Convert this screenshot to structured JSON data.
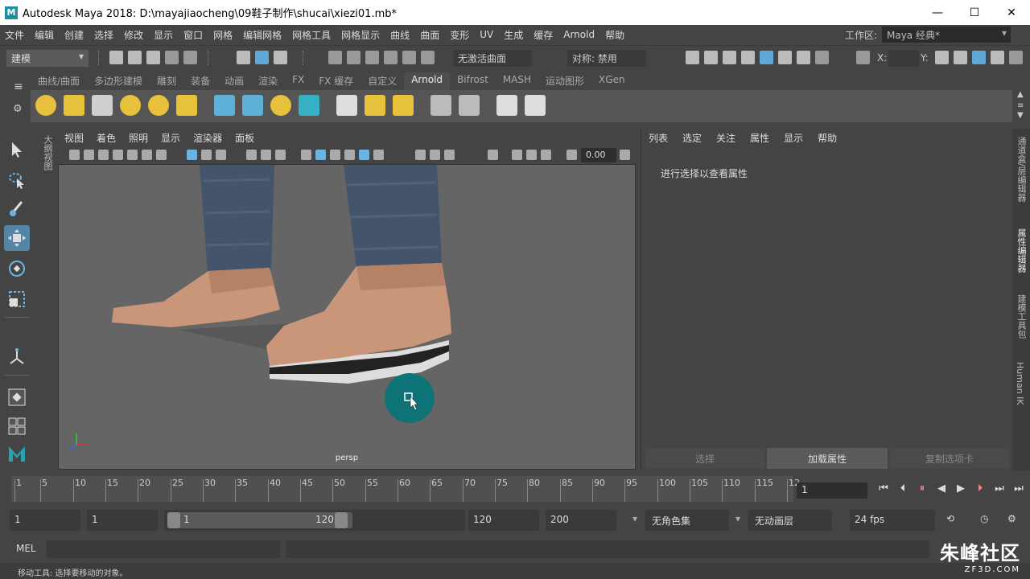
{
  "window": {
    "title": "Autodesk Maya 2018: D:\\mayajiaocheng\\09鞋子制作\\shucai\\xiezi01.mb*",
    "logo": "M",
    "minimize": "—",
    "maximize": "☐",
    "close": "✕"
  },
  "menubar": {
    "items": [
      "文件",
      "编辑",
      "创建",
      "选择",
      "修改",
      "显示",
      "窗口",
      "网格",
      "编辑网格",
      "网格工具",
      "网格显示",
      "曲线",
      "曲面",
      "变形",
      "UV",
      "生成",
      "缓存",
      "Arnold",
      "帮助"
    ],
    "workspace_label": "工作区:",
    "workspace_value": "Maya 经典*"
  },
  "statusline": {
    "mode": "建模",
    "live_surface": "无激活曲面",
    "symmetry": "对称: 禁用",
    "x_label": "X:",
    "y_label": "Y:"
  },
  "shelf": {
    "tabs": [
      "曲线/曲面",
      "多边形建模",
      "雕刻",
      "装备",
      "动画",
      "渲染",
      "FX",
      "FX 缓存",
      "自定义",
      "Arnold",
      "Bifrost",
      "MASH",
      "运动图形",
      "XGen"
    ],
    "active_tab": "Arnold",
    "icons": [
      "sun-light-icon",
      "spot-light-icon",
      "area-light-icon",
      "skydome-icon",
      "photometric-icon",
      "physical-sky-icon",
      "standin-icon",
      "volume-icon",
      "curve-collector-icon",
      "mesh-light-icon",
      "flush-cache-icon",
      "texture-icon",
      "tx-manager-icon",
      "license-icon",
      "render-view-icon",
      "render-icon"
    ]
  },
  "outliner_label": "大纲视图",
  "viewport": {
    "menu": [
      "视图",
      "着色",
      "照明",
      "显示",
      "渲染器",
      "面板"
    ],
    "value": "0.00",
    "camera_label": "persp"
  },
  "attr_editor": {
    "menu": [
      "列表",
      "选定",
      "关注",
      "属性",
      "显示",
      "帮助"
    ],
    "message": "进行选择以查看属性",
    "buttons": [
      "选择",
      "加载属性",
      "复制选项卡"
    ]
  },
  "right_tabs": [
    "通道盒/层编辑器",
    "属性编辑器",
    "建模工具包",
    "Human IK"
  ],
  "timeslider": {
    "ticks": [
      "1",
      "5",
      "10",
      "15",
      "20",
      "25",
      "30",
      "35",
      "40",
      "45",
      "50",
      "55",
      "60",
      "65",
      "70",
      "75",
      "80",
      "85",
      "90",
      "95",
      "100",
      "105",
      "110",
      "115",
      "12"
    ],
    "current_frame": "1",
    "controls": [
      "⏮",
      "⏴|",
      "|◀",
      "◀",
      "▶",
      "▶|",
      "⏭",
      "⏭"
    ]
  },
  "range": {
    "start": "1",
    "anim_start": "1",
    "range_start": "1",
    "range_end": "120",
    "end": "120",
    "anim_end": "200",
    "char_set": "无角色集",
    "anim_layer": "无动画层",
    "fps": "24 fps"
  },
  "cmdline": {
    "mel": "MEL",
    "help": "移动工具: 选择要移动的对象。"
  },
  "watermark": {
    "text": "朱峰社区",
    "url": "ZF3D.COM"
  },
  "colors": {
    "accent": "#5285a6",
    "teal_cursor": "#0e7377",
    "arnold_yellow": "#e8c13c",
    "maya_teal": "#1e8fa0"
  }
}
